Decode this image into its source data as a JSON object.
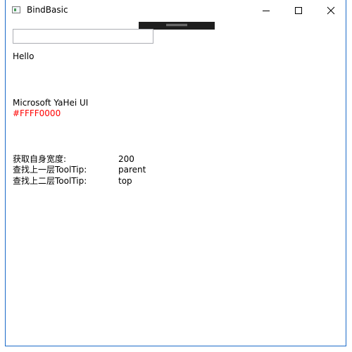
{
  "window": {
    "title": "BindBasic"
  },
  "icons": {
    "app": "window-app-icon",
    "minimize": "minimize-icon",
    "maximize": "maximize-icon",
    "close": "close-icon"
  },
  "main": {
    "textbox_value": "",
    "hello": "Hello",
    "font_family": "Microsoft YaHei UI",
    "foreground_color": "#FFFF0000",
    "rows": [
      {
        "label": "获取自身宽度:",
        "value": "200"
      },
      {
        "label": "查找上一层ToolTip:",
        "value": "parent"
      },
      {
        "label": "查找上二层ToolTip:",
        "value": "top"
      }
    ]
  },
  "colors": {
    "accent": "#1b6ac9",
    "red_text": "#ff0000"
  }
}
